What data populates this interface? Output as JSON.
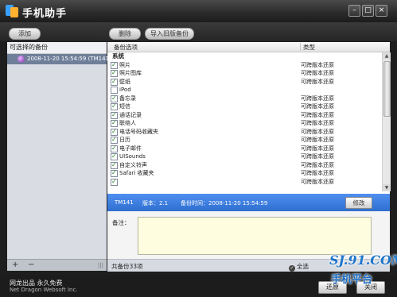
{
  "app": {
    "title": "手机助手"
  },
  "toolbar": {
    "add": "添加",
    "delete": "删除",
    "import": "导入旧版备份"
  },
  "left_panel": {
    "header": "可选择的备份",
    "items": [
      "2008-11-20 15:54:59 (TM141"
    ]
  },
  "backup_table": {
    "columns": [
      "备份选项",
      "类型"
    ],
    "group": "系统",
    "rows": [
      {
        "name": "照片",
        "type": "可跨版本还原",
        "checked": true
      },
      {
        "name": "照片图库",
        "type": "可跨版本还原",
        "checked": true
      },
      {
        "name": "壁纸",
        "type": "可跨版本还原",
        "checked": true
      },
      {
        "name": "iPod",
        "type": "",
        "checked": false
      },
      {
        "name": "备忘录",
        "type": "可跨版本还原",
        "checked": true
      },
      {
        "name": "短信",
        "type": "可跨版本还原",
        "checked": true
      },
      {
        "name": "通话记录",
        "type": "可跨版本还原",
        "checked": true
      },
      {
        "name": "联络人",
        "type": "可跨版本还原",
        "checked": true
      },
      {
        "name": "电话号码收藏夹",
        "type": "可跨版本还原",
        "checked": true
      },
      {
        "name": "日历",
        "type": "可跨版本还原",
        "checked": true
      },
      {
        "name": "电子邮件",
        "type": "可跨版本还原",
        "checked": true
      },
      {
        "name": "UISounds",
        "type": "可跨版本还原",
        "checked": true
      },
      {
        "name": "自定义铃声",
        "type": "可跨版本还原",
        "checked": true
      },
      {
        "name": "Safari 收藏夹",
        "type": "可跨版本还原",
        "checked": true
      },
      {
        "name": "",
        "type": "可跨版本还原",
        "checked": true
      }
    ]
  },
  "info_bar": {
    "device": "TM141",
    "version": "版本：2.1",
    "backup_time": "备份时间：2008-11-20 15:54:59",
    "edit_button": "修改"
  },
  "notes": {
    "label": "备注：",
    "value": ""
  },
  "status": {
    "count": "共备份33项",
    "select_all": "全选"
  },
  "footer": {
    "brand_cn": "网龙出品 永久免费",
    "brand_en": "Net Dragon Websoft Inc.",
    "restore": "还原",
    "close": "关闭"
  },
  "watermark": {
    "site": "SJ.91.COM",
    "text": "手机平台"
  },
  "colors": {
    "info_bar": "#3a7de0",
    "selection": "#6f7f99",
    "notes_bg": "#fffde0"
  }
}
